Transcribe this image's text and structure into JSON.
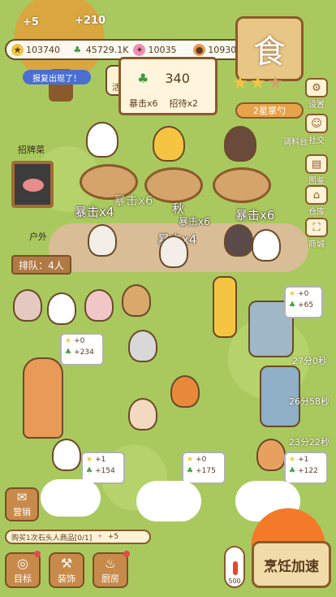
{
  "float_plus": [
    "+5",
    "+210"
  ],
  "resources": {
    "coins": "103740",
    "clover": "45729.1K",
    "candy": "10035",
    "cookie": "10930"
  },
  "banner": "报复出现了！",
  "activity_label": "活动",
  "board": {
    "value": "340",
    "crit": "暴击x6",
    "wait": "招待x2"
  },
  "shop_sign_char": "食",
  "rank": "2星掌勺",
  "stars_filled": 2,
  "stars_total": 5,
  "side_menu": [
    {
      "label": "设置",
      "icon": "gear-icon",
      "glyph": "⚙"
    },
    {
      "label": "社交",
      "icon": "people-icon",
      "glyph": "☺"
    },
    {
      "label": "调料台",
      "icon": "spice-icon",
      "glyph": "◉"
    },
    {
      "label": "图鉴",
      "icon": "book-icon",
      "glyph": "▤"
    },
    {
      "label": "仓库",
      "icon": "warehouse-icon",
      "glyph": "⌂"
    },
    {
      "label": "商城",
      "icon": "store-icon",
      "glyph": "⛶"
    }
  ],
  "signature_dish": "招牌菜",
  "outdoor": "户外",
  "queue": "排队：4人",
  "crit_texts": [
    "暴击x4",
    "暴击x6",
    "暴击x4",
    "暴击x6",
    "秋",
    "暴击x6"
  ],
  "bubbles": [
    {
      "star": "+0",
      "clover": "+234"
    },
    {
      "star": "+0",
      "clover": "+65"
    },
    {
      "star": "+1",
      "clover": "+154"
    },
    {
      "star": "+0",
      "clover": "+175"
    },
    {
      "star": "+1",
      "clover": "+122"
    }
  ],
  "timers": [
    "27分0秒",
    "26分58秒",
    "23分22秒"
  ],
  "task": {
    "text": "购买1次石头人商品[0/1]",
    "reward": "+5"
  },
  "bottom_buttons": [
    {
      "label": "目标",
      "icon": "target-icon",
      "glyph": "◎"
    },
    {
      "label": "装饰",
      "icon": "hammer-icon",
      "glyph": "⚒"
    },
    {
      "label": "厨房",
      "icon": "pot-icon",
      "glyph": "♨"
    }
  ],
  "marketing": "营销",
  "thermometer": "500",
  "thermometer_level": 0.55,
  "cook_speed": "烹饪加速",
  "colors": {
    "grass": "#a9c95f",
    "wood": "#8b5a2b",
    "accent": "#e8a24a"
  }
}
